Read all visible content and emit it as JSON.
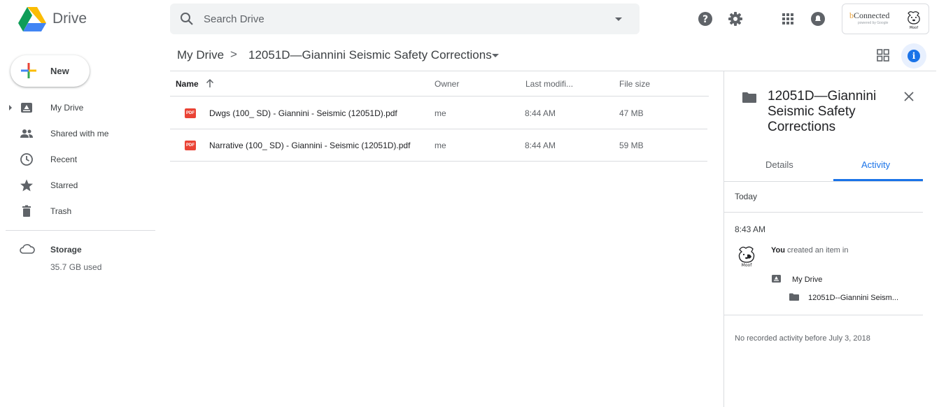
{
  "app": {
    "name": "Drive"
  },
  "search": {
    "placeholder": "Search Drive"
  },
  "account": {
    "brand_prefix": "b",
    "brand_rest": "Connected",
    "powered": "powered by Google",
    "avatar_caption": "Moof"
  },
  "sidebar": {
    "new_label": "New",
    "items": [
      {
        "label": "My Drive"
      },
      {
        "label": "Shared with me"
      },
      {
        "label": "Recent"
      },
      {
        "label": "Starred"
      },
      {
        "label": "Trash"
      }
    ],
    "storage": {
      "label": "Storage",
      "used": "35.7 GB used"
    }
  },
  "breadcrumb": {
    "root": "My Drive",
    "separator": ">",
    "current": "12051D—Giannini Seismic Safety Corrections"
  },
  "table": {
    "headers": {
      "name": "Name",
      "owner": "Owner",
      "modified": "Last modifi...",
      "size": "File size"
    },
    "rows": [
      {
        "name": "Dwgs (100_ SD) - Giannini - Seismic (12051D).pdf",
        "owner": "me",
        "modified": "8:44 AM",
        "size": "47 MB",
        "type": "PDF"
      },
      {
        "name": "Narrative (100_ SD) - Giannini - Seismic (12051D).pdf",
        "owner": "me",
        "modified": "8:44 AM",
        "size": "59 MB",
        "type": "PDF"
      }
    ]
  },
  "panel": {
    "title": "12051D—Giannini Seismic Safety Corrections",
    "tabs": {
      "details": "Details",
      "activity": "Activity"
    },
    "today": "Today",
    "time": "8:43 AM",
    "actor": "You",
    "action": " created an item in",
    "location_root": "My Drive",
    "location_folder": "12051D--Giannini Seism...",
    "no_record": "No recorded activity before July 3, 2018"
  },
  "colors": {
    "accent": "#1a73e8",
    "pdf": "#ea4335"
  }
}
